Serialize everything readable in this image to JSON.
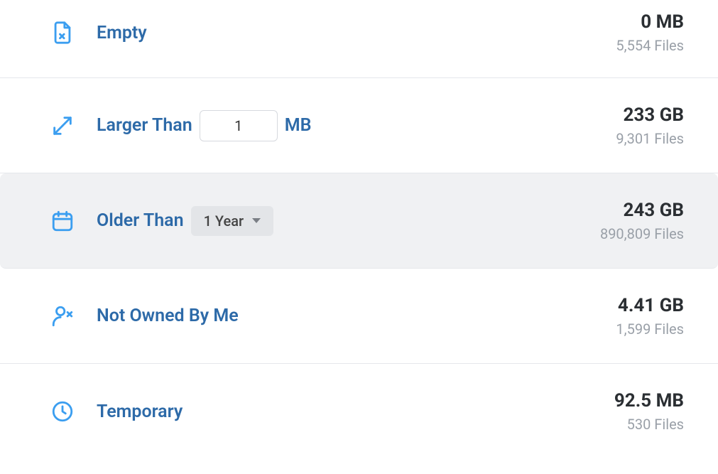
{
  "rows": {
    "empty": {
      "label": "Empty",
      "size": "0 MB",
      "files": "5,554 Files"
    },
    "larger_than": {
      "label_prefix": "Larger Than",
      "value": "1",
      "unit": "MB",
      "size": "233 GB",
      "files": "9,301 Files"
    },
    "older_than": {
      "label_prefix": "Older Than",
      "dropdown_value": "1 Year",
      "size": "243 GB",
      "files": "890,809 Files"
    },
    "not_owned": {
      "label": "Not Owned By Me",
      "size": "4.41 GB",
      "files": "1,599 Files"
    },
    "temporary": {
      "label": "Temporary",
      "size": "92.5 MB",
      "files": "530 Files"
    }
  }
}
